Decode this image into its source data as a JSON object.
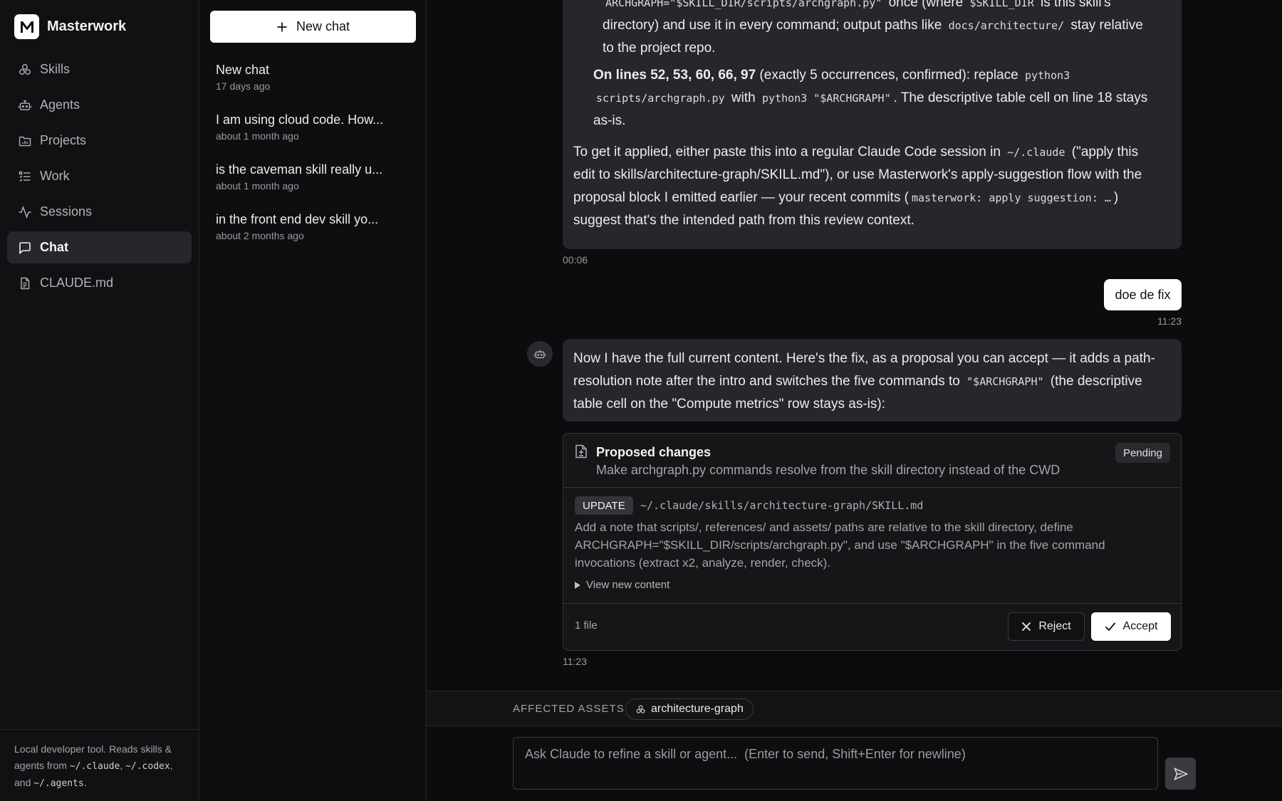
{
  "app": {
    "name": "Masterwork"
  },
  "nav": [
    {
      "label": "Skills",
      "icon": "skills-icon"
    },
    {
      "label": "Agents",
      "icon": "robot-icon"
    },
    {
      "label": "Projects",
      "icon": "folder-icon"
    },
    {
      "label": "Work",
      "icon": "list-icon"
    },
    {
      "label": "Sessions",
      "icon": "activity-icon"
    },
    {
      "label": "Chat",
      "icon": "chat-icon",
      "active": true
    },
    {
      "label": "CLAUDE.md",
      "icon": "file-icon"
    }
  ],
  "footer": {
    "line1": "Local developer tool. Reads skills &",
    "agents_from": "agents from",
    "path1": "~/.claude",
    "sep1": ",",
    "path2": "~/.codex",
    "and": "and",
    "path3": "~/.agents",
    "end": "."
  },
  "history": {
    "new_chat_label": "New chat",
    "items": [
      {
        "title": "New chat",
        "time": "17 days ago"
      },
      {
        "title": "I am using cloud code. How...",
        "time": "about 1 month ago"
      },
      {
        "title": "is the caveman skill really u...",
        "time": "about 1 month ago"
      },
      {
        "title": "in the front end dev skill yo...",
        "time": "about 2 months ago"
      }
    ]
  },
  "messages": {
    "m1": {
      "l1_code1": "ARCHGRAPH=\"$SKILL_DIR/scripts/archgraph.py\"",
      "l1_t1": "once (where",
      "l1_code2": "$SKILL_DIR",
      "l1_t2": "is this skill's",
      "l2_t1": "directory) and use it in every command; output paths like",
      "l2_code": "docs/architecture/",
      "l2_t2": "stay relative",
      "l3": "to the project repo.",
      "lines_bold": "On lines 52, 53, 60, 66, 97",
      "lines_t1": "(exactly 5 occurrences, confirmed): replace",
      "lines_code1": "python3",
      "lines_code2": "scripts/archgraph.py",
      "lines_t2": "with",
      "lines_code3": "python3 \"$ARCHGRAPH\"",
      "lines_t3": ". The descriptive table cell on line 18 stays",
      "lines_t4": "as-is.",
      "p_t1": "To get it applied, either paste this into a regular Claude Code session in",
      "p_code1": "~/.claude",
      "p_t2": "(\"apply this",
      "p_t3": "edit to skills/architecture-graph/SKILL.md\"), or use Masterwork's apply-suggestion flow with the",
      "p_t4": "proposal block I emitted earlier — your recent commits (",
      "p_code2": "masterwork: apply suggestion: …",
      "p_t5": ")",
      "p_t6": "suggest that's the intended path from this review context.",
      "time": "00:06"
    },
    "user": {
      "text": "doe de fix",
      "time": "11:23"
    },
    "m2": {
      "t1": "Now I have the full current content. Here's the fix, as a proposal you can accept — it adds a path-",
      "t2": "resolution note after the intro and switches the five commands to",
      "code": "\"$ARCHGRAPH\"",
      "t3": "(the descriptive",
      "t4": "table cell on the \"Compute metrics\" row stays as-is):"
    }
  },
  "proposal": {
    "title": "Proposed changes",
    "subtitle": "Make archgraph.py commands resolve from the skill directory instead of the CWD",
    "status": "Pending",
    "op": "UPDATE",
    "path": "~/.claude/skills/architecture-graph/SKILL.md",
    "description": "Add a note that scripts/, references/ and assets/ paths are relative to the skill directory, define ARCHGRAPH=\"$SKILL_DIR/scripts/archgraph.py\", and use \"$ARCHGRAPH\" in the five command invocations (extract x2, analyze, render, check).",
    "view_new": "View new content",
    "file_count": "1 file",
    "reject_label": "Reject",
    "accept_label": "Accept",
    "time": "11:23"
  },
  "assets": {
    "label": "AFFECTED ASSETS",
    "chip": "architecture-graph"
  },
  "composer": {
    "placeholder": "Ask Claude to refine a skill or agent...  (Enter to send, Shift+Enter for newline)"
  }
}
